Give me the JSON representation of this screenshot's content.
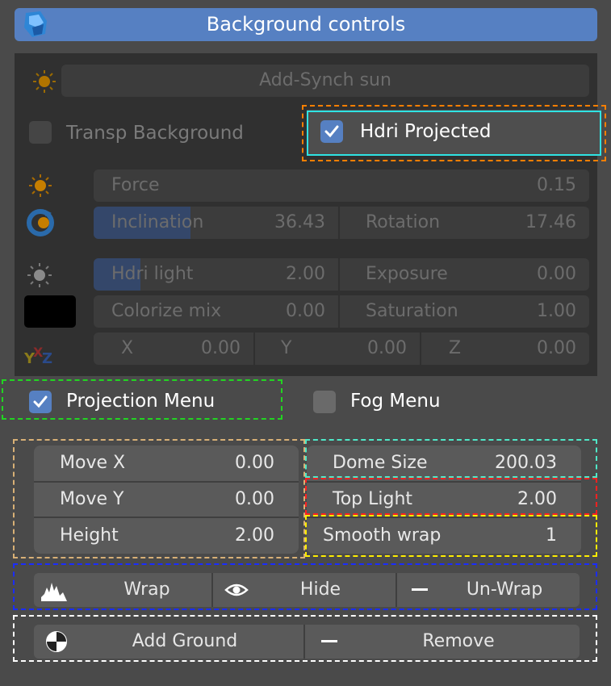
{
  "header": {
    "title": "Background controls",
    "icon": "blender-logo-icon"
  },
  "sun": {
    "label": "Add-Synch sun",
    "icon": "sun-icon"
  },
  "transp_background": {
    "label": "Transp Background",
    "checked": false
  },
  "hdri_projected": {
    "label": "Hdri Projected",
    "checked": true
  },
  "force": {
    "label": "Force",
    "value": "0.15"
  },
  "inclination": {
    "label": "Inclination",
    "value": "36.43",
    "fill_fraction": 0.4
  },
  "rotation": {
    "label": "Rotation",
    "value": "17.46"
  },
  "hdri_light": {
    "label": "Hdri light",
    "value": "2.00",
    "fill_fraction": 0.19
  },
  "exposure": {
    "label": "Exposure",
    "value": "0.00"
  },
  "colorize_mix": {
    "label": "Colorize mix",
    "value": "0.00"
  },
  "saturation": {
    "label": "Saturation",
    "value": "1.00"
  },
  "color_swatch": {
    "color": "#000000"
  },
  "xyz": {
    "icon": "xyz-axes-icon",
    "x_label": "X",
    "x_value": "0.00",
    "y_label": "Y",
    "y_value": "0.00",
    "z_label": "Z",
    "z_value": "0.00"
  },
  "projection_menu": {
    "label": "Projection Menu",
    "checked": true
  },
  "fog_menu": {
    "label": "Fog Menu",
    "checked": false
  },
  "move_x": {
    "label": "Move X",
    "value": "0.00"
  },
  "move_y": {
    "label": "Move Y",
    "value": "0.00"
  },
  "height": {
    "label": "Height",
    "value": "2.00"
  },
  "dome_size": {
    "label": "Dome Size",
    "value": "200.03"
  },
  "top_light": {
    "label": "Top Light",
    "value": "2.00"
  },
  "smooth_wrap": {
    "label": "Smooth wrap",
    "value": "1"
  },
  "actions": {
    "wrap": "Wrap",
    "hide": "Hide",
    "unwrap": "Un-Wrap",
    "add_ground": "Add Ground",
    "remove": "Remove"
  },
  "colors": {
    "accent": "#5680c2",
    "highlight_orange": "#ff7f00",
    "highlight_cyan": "#2fe3e3",
    "highlight_green": "#22d422",
    "highlight_tan": "#d8b076",
    "highlight_teal": "#4fe8c8",
    "highlight_red": "#ff2020",
    "highlight_yellow": "#ffee00",
    "highlight_blue": "#1a2cff",
    "highlight_white": "#ffffff"
  }
}
